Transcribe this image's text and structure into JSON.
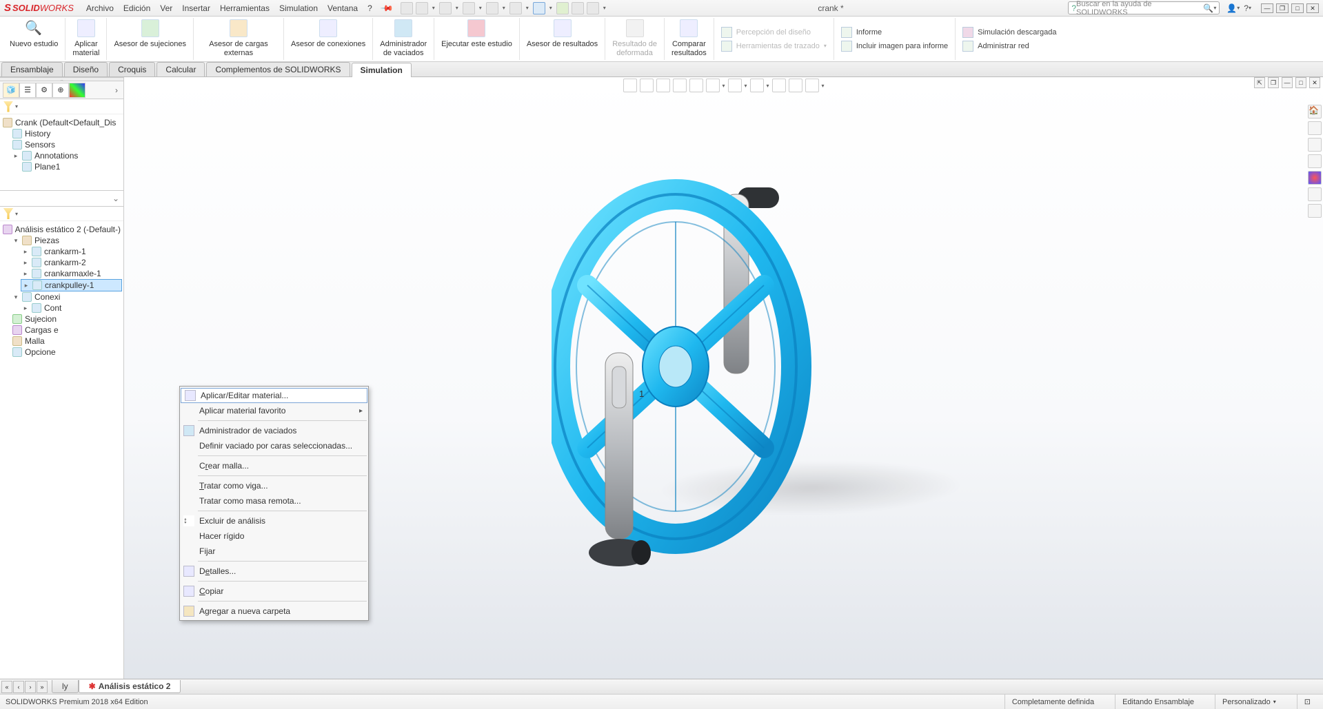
{
  "app": {
    "logo1": "S",
    "logo2": "SOLID",
    "logo3": "WORKS"
  },
  "menu": [
    "Archivo",
    "Edición",
    "Ver",
    "Insertar",
    "Herramientas",
    "Simulation",
    "Ventana",
    "?"
  ],
  "doc_title": "crank *",
  "search_placeholder": "Buscar en la ayuda de SOLIDWORKS",
  "ribbon": {
    "nuevo_estudio": "Nuevo estudio",
    "aplicar_material": "Aplicar\nmaterial",
    "asesor_sujeciones": "Asesor de sujeciones",
    "asesor_cargas": "Asesor de cargas externas",
    "asesor_conexiones": "Asesor de conexiones",
    "admin_vaciados": "Administrador\nde vaciados",
    "ejecutar": "Ejecutar este estudio",
    "asesor_resultados": "Asesor de resultados",
    "resultado_deformada": "Resultado de\ndeformada",
    "comparar": "Comparar\nresultados",
    "percepcion": "Percepción del diseño",
    "herramientas_trazado": "Herramientas de trazado",
    "informe": "Informe",
    "incluir_imagen": "Incluir imagen para informe",
    "sim_descargada": "Simulación descargada",
    "admin_red": "Administrar red"
  },
  "tabs": {
    "ensamblaje": "Ensamblaje",
    "diseno": "Diseño",
    "croquis": "Croquis",
    "calcular": "Calcular",
    "complementos": "Complementos de SOLIDWORKS",
    "simulation": "Simulation"
  },
  "tree1": {
    "root": "Crank  (Default<Default_Dis",
    "history": "History",
    "sensors": "Sensors",
    "annotations": "Annotations",
    "plane1": "Plane1"
  },
  "tree2": {
    "study": "Análisis estático 2 (-Default-)",
    "piezas": "Piezas",
    "p1": "crankarm-1",
    "p2": "crankarm-2",
    "p3": "crankarmaxle-1",
    "p4": "crankpulley-1",
    "conexiones": "Conexi",
    "contacto": "Cont",
    "sujeciones": "Sujecion",
    "cargas": "Cargas e",
    "malla": "Malla",
    "opciones": "Opcione"
  },
  "ctx": {
    "m1": "Aplicar/Editar material...",
    "m2": "Aplicar material favorito",
    "m3": "Administrador de vaciados",
    "m4": "Definir vaciado por caras seleccionadas...",
    "m5_pre": "C",
    "m5_u": "r",
    "m5_post": "ear malla...",
    "m6_u": "T",
    "m6_post": "ratar como viga...",
    "m7": "Tratar como masa remota...",
    "m8": "Excluir de análisis",
    "m9": "Hacer rígido",
    "m10": "Fijar",
    "m11_pre": "D",
    "m11_u": "e",
    "m11_post": "talles...",
    "m12_u": "C",
    "m12_post": "opiar",
    "m13": "Agregar a nueva carpeta"
  },
  "bottom_tabs": {
    "t1": "ly",
    "t2": "Análisis estático 2"
  },
  "status": {
    "edition": "SOLIDWORKS Premium 2018 x64 Edition",
    "defined": "Completamente definida",
    "editing": "Editando Ensamblaje",
    "custom": "Personalizado"
  }
}
